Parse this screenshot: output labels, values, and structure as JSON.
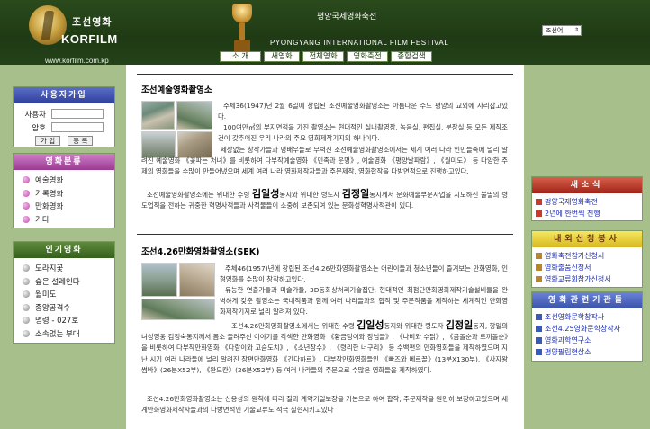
{
  "header": {
    "logo_kor": "조선영화",
    "logo_en": "KORFILM",
    "logo_url": "www.korfilm.com.kp",
    "festival_kor": "평양국제영화축전",
    "festival_en": "PYONGYANG INTERNATIONAL FILM FESTIVAL",
    "language_select": "조선어"
  },
  "nav": [
    "소   개",
    "새영화",
    "전체영화",
    "영화축전",
    "종합검색"
  ],
  "login": {
    "title": "사용자가입",
    "user_label": "사용자",
    "password_label": "암호",
    "join_button": "가 입",
    "register_button": "등 록"
  },
  "film_categories": {
    "title": "영화분류",
    "items": [
      "예술영화",
      "기록영화",
      "만화영화",
      "기타"
    ]
  },
  "popular_films": {
    "title": "인기영화",
    "items": [
      "도라지꽃",
      "숲은 설레인다",
      "월미도",
      "종양공격수",
      "명령 - 027호",
      "소속없는 부대"
    ]
  },
  "main": {
    "section1_title": "조선예술영화촬영소",
    "section1_p1": "주체36(1947)년 2월 6일에 창립된 조선예술영화촬영소는 아름다운 수도 평양의 교외에 자리잡고있다.",
    "section1_p2": "100여만㎡의 부지면적을 가진 촬영소는 현대적인 실내촬영장, 녹음실, 편집실, 분장실 등 모든 제작조건이 갖추어진 우리 나라의 주요 영화제작기지의 하나이다.",
    "section1_p3": "세상없는 창작가들과 명배우들로 무력진 조선예술영화촬영소에서는 세계 여러 나라 인민들속에 널리 알려진 예술영화 《꽃파는 처녀》를 비롯하여 다부작예술영화 《민족과 운명》, 예술영화 《평양날파람》, 《월미도》 등 다양한 주제의 영화들을 수많이 만들어냈으며 세계 여러 나라 영화제작자들과 주문제작, 영화합작을 다방면적으로 진행하고있다.",
    "section1_p4a": "조선예술영화촬영소에는 위대한 수령 ",
    "section1_name1": "김일성",
    "section1_p4b": "동지와 위대한 령도자 ",
    "section1_name2": "김정일",
    "section1_p4c": "동지께서 문화예술부문사업을 지도하신 불멸의 령도업적을 전하는 귀중한 혁명사적들과 사적물들이 소중히 보존되여 있는 문화성혁명사적관이 있다.",
    "section2_title": "조선4.26만화영화촬영소(SEK)",
    "section2_p1": "주체46(1957)년에 창립된 조선4.26만화영화촬영소는 어린이들과 청소년들이 즐겨보는 만화영화, 인형영화를 수많이 창작하고있다.",
    "section2_p2": "유능한 연출가들과 미술가들, 3D동화상처리기술집단, 현대적인 최첨단만화영화제작기술설비들을 완벽하게 갖춘 촬영소는 국내적품과 함께 여러 나라들과의 합작 및 주문작품을 제작하는 세계적인 만화영화제작기지로 널리 알려져 있다.",
    "section2_p3a": "조선4.26만화영화촬영소에서는 위대한 수령 ",
    "section2_name1": "김일성",
    "section2_p3b": "동지와 위대한 령도자 ",
    "section2_name2": "김정일",
    "section2_p3c": "동지, 항일의 녀성영웅 김정숙동지께서 몸소 들려주신 이야기를 각색한 만화영화 《황금덩이와 장님들》, 《나비와 수탉》, 《곰돌순과 토끼돌순》을 비롯하여 다부작만화영화 《다람이와 고슴도치》, 《소년장수》, 《령리한 너구리》 등 수백편의 만화영화들을 제작하였으며 지난 시기 여러 나라들에 널리 알려진 장편만화영화 《간다하르》, 다부작만화영화들인 《빠즈와 메르꼴》(13분X130부), 《사자왕 썸바》(26분X52부), 《완드칸》(26분X52부) 등 여러 나라들의 주문으로 수많은 영화들을 제작하였다.",
    "section2_p4": "조선4.26만화영화촬영소는 신용성의 원칙에 따라 질과 계약기일보장을 기본으로 하여 합작, 주문제작을 원만히 보장하고있으며 세계만화영화제작자들과의 다방면적인 기술교류도 적극 실현시키고있다"
  },
  "right": {
    "notice_title": "새소식",
    "notice_items": [
      "평양국제영화축전",
      "2년에 한번씩 진행"
    ],
    "apply_title": "내외신청봉사",
    "apply_items": [
      "영화축전참가신청서",
      "영화출품신청서",
      "영화교류회참가신청서"
    ],
    "related_title": "영화관련기관들",
    "related_items": [
      "조선영화문학창작사",
      "조선4.25영화문학창작사",
      "영화과학연구소",
      "평양필림현상소"
    ]
  },
  "colors": {
    "header_bg": "#24421a",
    "side_bg": "#a7c08b",
    "login_title": "#2e3f9a",
    "category_title": "#9a3a92",
    "popular_title": "#35601c",
    "notice_title": "#a02418",
    "apply_title": "#d8b820",
    "related_title": "#3a52a8"
  }
}
